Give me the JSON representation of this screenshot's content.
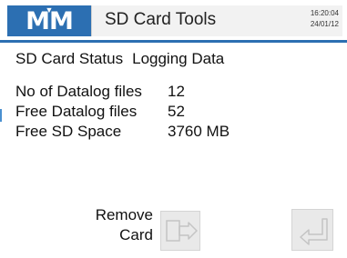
{
  "header": {
    "logo_text": "MM",
    "title": "SD Card Tools",
    "time": "16:20:04",
    "date": "24/01/12"
  },
  "status": {
    "label": "SD Card Status",
    "value": "Logging Data"
  },
  "info": [
    {
      "label": "No of Datalog files",
      "value": "12"
    },
    {
      "label": "Free Datalog files",
      "value": "52"
    },
    {
      "label": "Free SD Space",
      "value": "3760 MB"
    }
  ],
  "actions": {
    "remove_label_line1": "Remove",
    "remove_label_line2": "Card"
  },
  "icons": {
    "remove": "card-eject-icon",
    "return": "return-arrow-icon"
  },
  "colors": {
    "brand": "#2c6fb2",
    "button": "#e9e9e9"
  }
}
